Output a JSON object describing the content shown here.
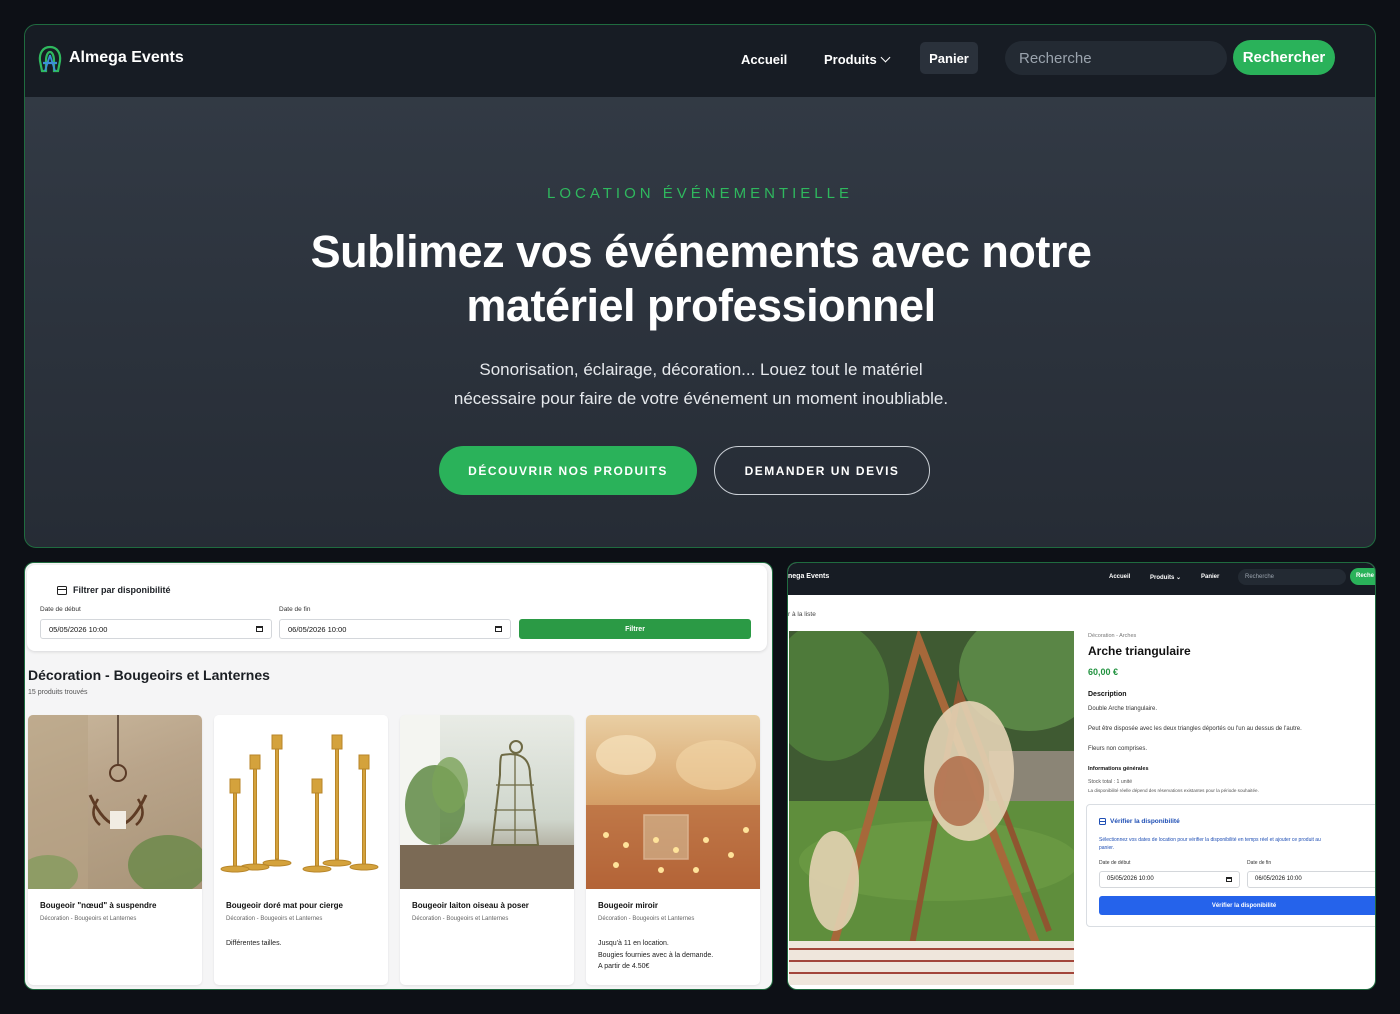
{
  "hero_page": {
    "brand": "Almega Events",
    "nav": {
      "home": "Accueil",
      "products": "Produits",
      "cart": "Panier"
    },
    "search": {
      "placeholder": "Recherche",
      "button": "Rechercher"
    },
    "eyebrow": "LOCATION ÉVÉNEMENTIELLE",
    "title_line1": "Sublimez vos événements avec notre",
    "title_line2": "matériel professionnel",
    "subtitle_line1": "Sonorisation, éclairage, décoration... Louez tout le matériel",
    "subtitle_line2": "nécessaire pour faire de votre événement un moment inoubliable.",
    "cta_primary": "DÉCOUVRIR NOS PRODUITS",
    "cta_secondary": "DEMANDER UN DEVIS"
  },
  "listing_page": {
    "filter": {
      "title": "Filtrer par disponibilité",
      "start_label": "Date de début",
      "start_value": "05/05/2026 10:00",
      "end_label": "Date de fin",
      "end_value": "06/05/2026 10:00",
      "button": "Filtrer"
    },
    "category_title": "Décoration - Bougeoirs et Lanternes",
    "count": "15 produits trouvés",
    "products": [
      {
        "name": "Bougeoir \"nœud\" à suspendre",
        "category": "Décoration - Bougeoirs et Lanternes",
        "desc1": "",
        "desc2": "",
        "desc3": ""
      },
      {
        "name": "Bougeoir doré mat pour cierge",
        "category": "Décoration - Bougeoirs et Lanternes",
        "desc1": "Différentes tailles.",
        "desc2": "",
        "desc3": ""
      },
      {
        "name": "Bougeoir laiton oiseau à poser",
        "category": "Décoration - Bougeoirs et Lanternes",
        "desc1": "",
        "desc2": "",
        "desc3": ""
      },
      {
        "name": "Bougeoir miroir",
        "category": "Décoration - Bougeoirs et Lanternes",
        "desc1": "Jusqu'à 11 en location.",
        "desc2": "Bougies fournies avec à la demande.",
        "desc3": "A partir de 4.50€"
      }
    ]
  },
  "detail_page": {
    "brand": "nega Events",
    "nav": {
      "home": "Accueil",
      "products": "Produits",
      "cart": "Panier"
    },
    "search": {
      "placeholder": "Recherche",
      "button": "Reche"
    },
    "back": "r à la liste",
    "category": "Décoration - Arches",
    "title": "Arche triangulaire",
    "price": "60,00 €",
    "description_heading": "Description",
    "desc1": "Double Arche triangulaire.",
    "desc2": "Peut être disposée avec les deux triangles déportés ou l'un au dessus de l'autre.",
    "desc3": "Fleurs non comprises.",
    "info_heading": "Informations générales",
    "stock": "Stock total : 1 unité",
    "availability_note": "La disponibilité réelle dépend des réservations existantes pour la période souhaitée.",
    "availability": {
      "title": "Vérifier la disponibilité",
      "desc_line1": "Sélectionnez vos dates de location pour vérifier la disponibilité en temps réel et ajouter ce produit au",
      "desc_line2": "panier.",
      "start_label": "Date de début",
      "start_value": "05/05/2026 10:00",
      "end_label": "Date de fin",
      "end_value": "06/05/2026 10:00",
      "button": "Vérifier la disponibilité"
    }
  },
  "colors": {
    "accent_green": "#2ab25a",
    "accent_blue": "#2563eb",
    "nav_dark": "#171c24",
    "frame_border": "#1f6b3f"
  }
}
